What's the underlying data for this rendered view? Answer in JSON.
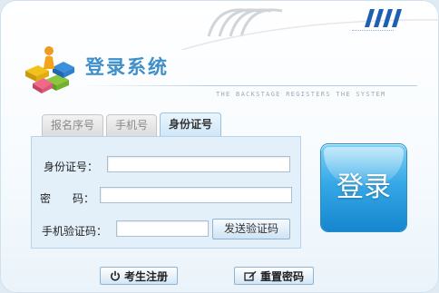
{
  "header": {
    "title": "登录系统",
    "subtitle": "THE BACKSTAGE REGISTERS THE SYSTEM"
  },
  "tabs": [
    {
      "label": "报名序号",
      "active": false
    },
    {
      "label": "手机号",
      "active": false
    },
    {
      "label": "身份证号",
      "active": true
    }
  ],
  "form": {
    "id_label": "身份证号：",
    "id_value": "",
    "password_label": "密　　码：",
    "password_value": "",
    "sms_label": "手机验证码：",
    "sms_value": "",
    "send_sms_label": "发送验证码"
  },
  "login": {
    "label": "登录"
  },
  "footer": {
    "register_label": "考生注册",
    "reset_label": "重置密码"
  },
  "colors": {
    "accent": "#3f8fca",
    "login_button": "#36a8e6",
    "form_bg": "#e3f0fa"
  }
}
